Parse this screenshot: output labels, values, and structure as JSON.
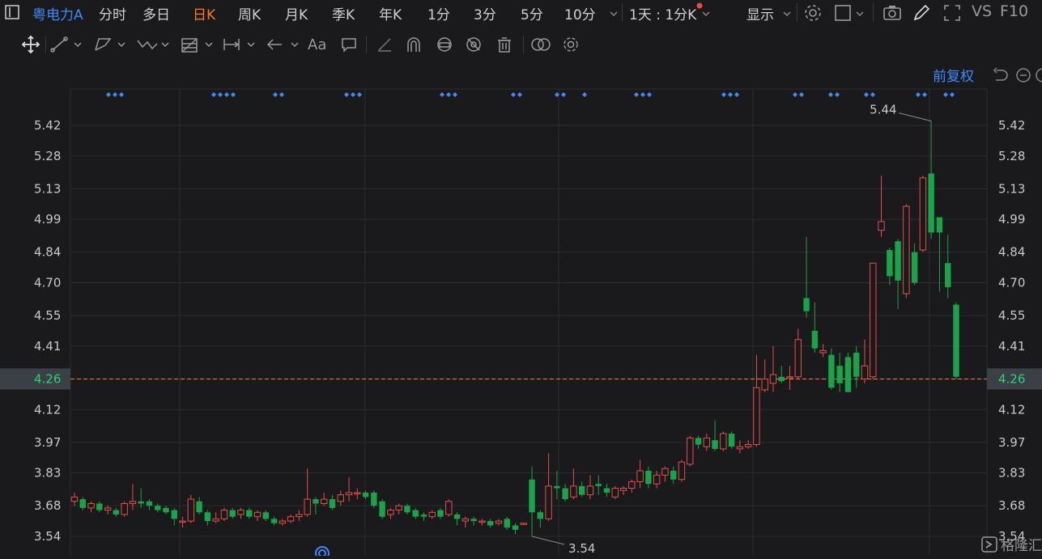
{
  "header": {
    "stock_name": "粤电力A",
    "tabs": [
      "分时",
      "多日",
      "日K",
      "周K",
      "月K",
      "季K",
      "年K",
      "1分",
      "3分",
      "5分",
      "10分"
    ],
    "active_tab": "日K",
    "period_selector": "1天 : 1分K",
    "display_menu": "显示",
    "vs_label": "VS",
    "f10_label": "F10"
  },
  "toolbar": {
    "text_tool_label": "Aa"
  },
  "adjust_label": "前复权",
  "watermark": "格隆汇",
  "colors": {
    "up": "#e84c4c",
    "down": "#1aa34a",
    "background": "#1a1a1c",
    "grid": "#2c2c2e",
    "accent": "#3d8bff",
    "price_line": "#ff7a3c"
  },
  "chart_data": {
    "type": "candlestick",
    "y_ticks": [
      "5.42",
      "5.28",
      "5.13",
      "4.99",
      "4.84",
      "4.70",
      "4.55",
      "4.41",
      "4.26",
      "4.12",
      "3.97",
      "3.83",
      "3.68",
      "3.54"
    ],
    "ylim": [
      3.53,
      5.5
    ],
    "current_price": "4.26",
    "max_annotation": "5.44",
    "min_annotation": "3.54",
    "candles": [
      [
        3.7,
        3.72,
        3.68,
        3.74
      ],
      [
        3.71,
        3.67,
        3.66,
        3.72
      ],
      [
        3.67,
        3.69,
        3.65,
        3.7
      ],
      [
        3.69,
        3.66,
        3.65,
        3.7
      ],
      [
        3.66,
        3.67,
        3.64,
        3.68
      ],
      [
        3.66,
        3.64,
        3.63,
        3.67
      ],
      [
        3.64,
        3.69,
        3.63,
        3.7
      ],
      [
        3.69,
        3.7,
        3.66,
        3.78
      ],
      [
        3.7,
        3.69,
        3.67,
        3.76
      ],
      [
        3.7,
        3.68,
        3.66,
        3.71
      ],
      [
        3.68,
        3.66,
        3.65,
        3.69
      ],
      [
        3.67,
        3.65,
        3.64,
        3.68
      ],
      [
        3.66,
        3.62,
        3.59,
        3.67
      ],
      [
        3.61,
        3.61,
        3.58,
        3.63
      ],
      [
        3.61,
        3.71,
        3.6,
        3.73
      ],
      [
        3.7,
        3.65,
        3.64,
        3.72
      ],
      [
        3.65,
        3.61,
        3.59,
        3.66
      ],
      [
        3.61,
        3.62,
        3.6,
        3.65
      ],
      [
        3.62,
        3.66,
        3.61,
        3.67
      ],
      [
        3.66,
        3.63,
        3.62,
        3.67
      ],
      [
        3.64,
        3.66,
        3.62,
        3.67
      ],
      [
        3.66,
        3.63,
        3.62,
        3.67
      ],
      [
        3.63,
        3.65,
        3.61,
        3.66
      ],
      [
        3.65,
        3.62,
        3.61,
        3.66
      ],
      [
        3.62,
        3.6,
        3.59,
        3.63
      ],
      [
        3.6,
        3.61,
        3.59,
        3.62
      ],
      [
        3.61,
        3.63,
        3.6,
        3.64
      ],
      [
        3.63,
        3.64,
        3.61,
        3.66
      ],
      [
        3.64,
        3.71,
        3.63,
        3.85
      ],
      [
        3.71,
        3.69,
        3.64,
        3.72
      ],
      [
        3.69,
        3.71,
        3.68,
        3.74
      ],
      [
        3.71,
        3.67,
        3.66,
        3.73
      ],
      [
        3.7,
        3.73,
        3.68,
        3.75
      ],
      [
        3.73,
        3.74,
        3.7,
        3.81
      ],
      [
        3.74,
        3.74,
        3.71,
        3.76
      ],
      [
        3.74,
        3.72,
        3.71,
        3.75
      ],
      [
        3.74,
        3.68,
        3.67,
        3.75
      ],
      [
        3.7,
        3.63,
        3.62,
        3.71
      ],
      [
        3.64,
        3.66,
        3.62,
        3.67
      ],
      [
        3.66,
        3.68,
        3.64,
        3.69
      ],
      [
        3.68,
        3.65,
        3.64,
        3.69
      ],
      [
        3.66,
        3.63,
        3.62,
        3.67
      ],
      [
        3.64,
        3.63,
        3.61,
        3.65
      ],
      [
        3.63,
        3.65,
        3.62,
        3.66
      ],
      [
        3.66,
        3.63,
        3.62,
        3.67
      ],
      [
        3.64,
        3.7,
        3.63,
        3.71
      ],
      [
        3.64,
        3.62,
        3.59,
        3.65
      ],
      [
        3.61,
        3.62,
        3.58,
        3.63
      ],
      [
        3.62,
        3.61,
        3.59,
        3.63
      ],
      [
        3.61,
        3.61,
        3.59,
        3.62
      ],
      [
        3.61,
        3.59,
        3.58,
        3.62
      ],
      [
        3.6,
        3.61,
        3.59,
        3.62
      ],
      [
        3.62,
        3.58,
        3.57,
        3.63
      ],
      [
        3.59,
        3.57,
        3.55,
        3.6
      ],
      [
        3.6,
        3.6,
        3.6,
        3.6
      ],
      [
        3.8,
        3.65,
        3.54,
        3.86
      ],
      [
        3.65,
        3.62,
        3.58,
        3.66
      ],
      [
        3.62,
        3.77,
        3.61,
        3.92
      ],
      [
        3.77,
        3.76,
        3.71,
        3.84
      ],
      [
        3.76,
        3.71,
        3.7,
        3.78
      ],
      [
        3.72,
        3.77,
        3.71,
        3.85
      ],
      [
        3.77,
        3.73,
        3.72,
        3.79
      ],
      [
        3.73,
        3.77,
        3.71,
        3.82
      ],
      [
        3.78,
        3.77,
        3.73,
        3.82
      ],
      [
        3.76,
        3.74,
        3.72,
        3.78
      ],
      [
        3.72,
        3.76,
        3.71,
        3.77
      ],
      [
        3.75,
        3.76,
        3.73,
        3.77
      ],
      [
        3.76,
        3.79,
        3.74,
        3.8
      ],
      [
        3.79,
        3.84,
        3.76,
        3.89
      ],
      [
        3.84,
        3.78,
        3.76,
        3.86
      ],
      [
        3.78,
        3.82,
        3.76,
        3.84
      ],
      [
        3.82,
        3.85,
        3.79,
        3.86
      ],
      [
        3.84,
        3.8,
        3.78,
        3.86
      ],
      [
        3.8,
        3.88,
        3.79,
        3.89
      ],
      [
        3.87,
        3.99,
        3.86,
        4.0
      ],
      [
        3.99,
        3.96,
        3.94,
        4.0
      ],
      [
        3.95,
        3.99,
        3.93,
        4.01
      ],
      [
        3.98,
        3.94,
        3.93,
        4.07
      ],
      [
        3.94,
        4.01,
        3.93,
        4.02
      ],
      [
        4.01,
        3.95,
        3.94,
        4.02
      ],
      [
        3.94,
        3.95,
        3.92,
        3.98
      ],
      [
        3.95,
        3.96,
        3.94,
        3.98
      ],
      [
        3.96,
        4.22,
        3.95,
        4.37
      ],
      [
        4.21,
        4.26,
        4.2,
        4.35
      ],
      [
        4.24,
        4.28,
        4.2,
        4.41
      ],
      [
        4.27,
        4.25,
        4.24,
        4.32
      ],
      [
        4.27,
        4.27,
        4.21,
        4.32
      ],
      [
        4.27,
        4.44,
        4.26,
        4.49
      ],
      [
        4.63,
        4.57,
        4.54,
        4.91
      ],
      [
        4.48,
        4.4,
        4.38,
        4.61
      ],
      [
        4.38,
        4.39,
        4.36,
        4.42
      ],
      [
        4.37,
        4.22,
        4.21,
        4.4
      ],
      [
        4.32,
        4.24,
        4.2,
        4.38
      ],
      [
        4.36,
        4.2,
        4.2,
        4.38
      ],
      [
        4.38,
        4.27,
        4.22,
        4.41
      ],
      [
        4.26,
        4.32,
        4.24,
        4.44
      ],
      [
        4.27,
        4.79,
        4.26,
        4.79
      ],
      [
        4.94,
        4.98,
        4.91,
        5.19
      ],
      [
        4.85,
        4.73,
        4.69,
        4.86
      ],
      [
        4.89,
        4.71,
        4.58,
        4.9
      ],
      [
        4.65,
        5.05,
        4.63,
        5.06
      ],
      [
        4.84,
        4.7,
        4.69,
        4.88
      ],
      [
        4.85,
        5.18,
        4.84,
        5.19
      ],
      [
        5.2,
        4.93,
        4.9,
        5.44
      ],
      [
        5.0,
        4.93,
        4.66,
        5.0
      ],
      [
        4.79,
        4.68,
        4.63,
        4.92
      ],
      [
        4.6,
        4.27,
        4.26,
        4.61
      ]
    ]
  }
}
